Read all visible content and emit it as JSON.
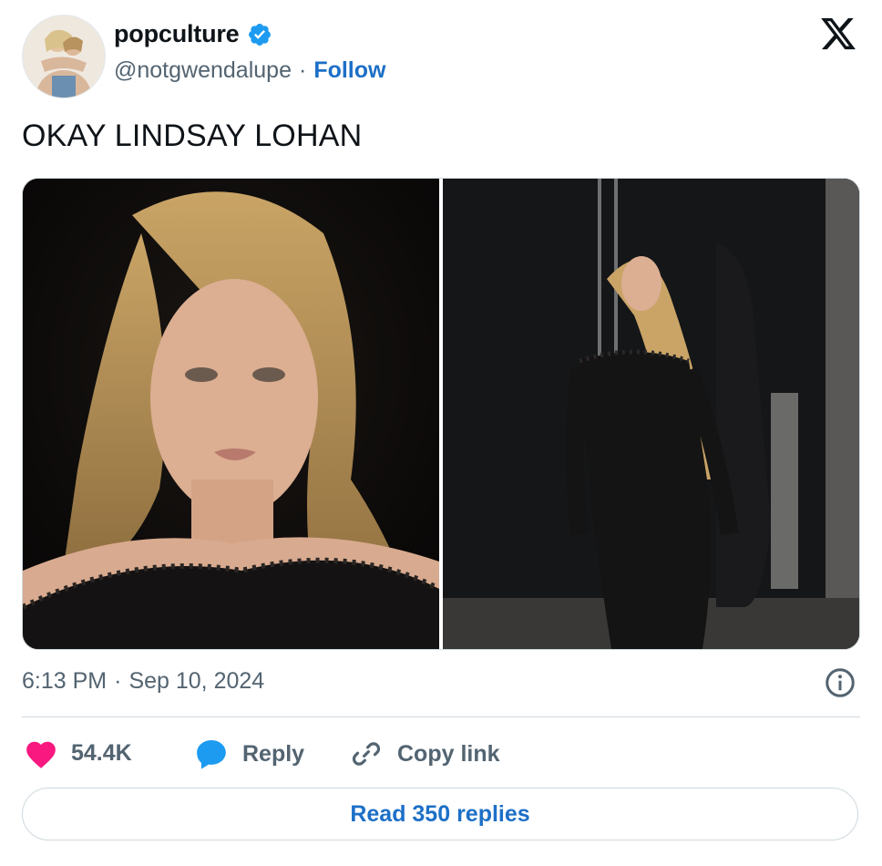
{
  "author": {
    "display_name": "popculture",
    "handle": "@notgwendalupe",
    "separator": "·",
    "follow_label": "Follow",
    "verified": true
  },
  "tweet": {
    "text": "OKAY LINDSAY LOHAN",
    "time": "6:13 PM",
    "date": "Sep 10, 2024",
    "separator": "·"
  },
  "actions": {
    "like_count": "54.4K",
    "reply_label": "Reply",
    "copy_link_label": "Copy link"
  },
  "read_replies_label": "Read 350 replies",
  "colors": {
    "accent": "#1d6fc7",
    "verified": "#1d9bf0",
    "like": "#f91880",
    "muted": "#536471",
    "border": "#cfd9de"
  },
  "icons": {
    "brand": "x-logo-icon",
    "verified": "verified-badge-icon",
    "info": "info-icon",
    "like": "heart-icon",
    "reply": "speech-bubble-icon",
    "copy": "link-icon"
  }
}
